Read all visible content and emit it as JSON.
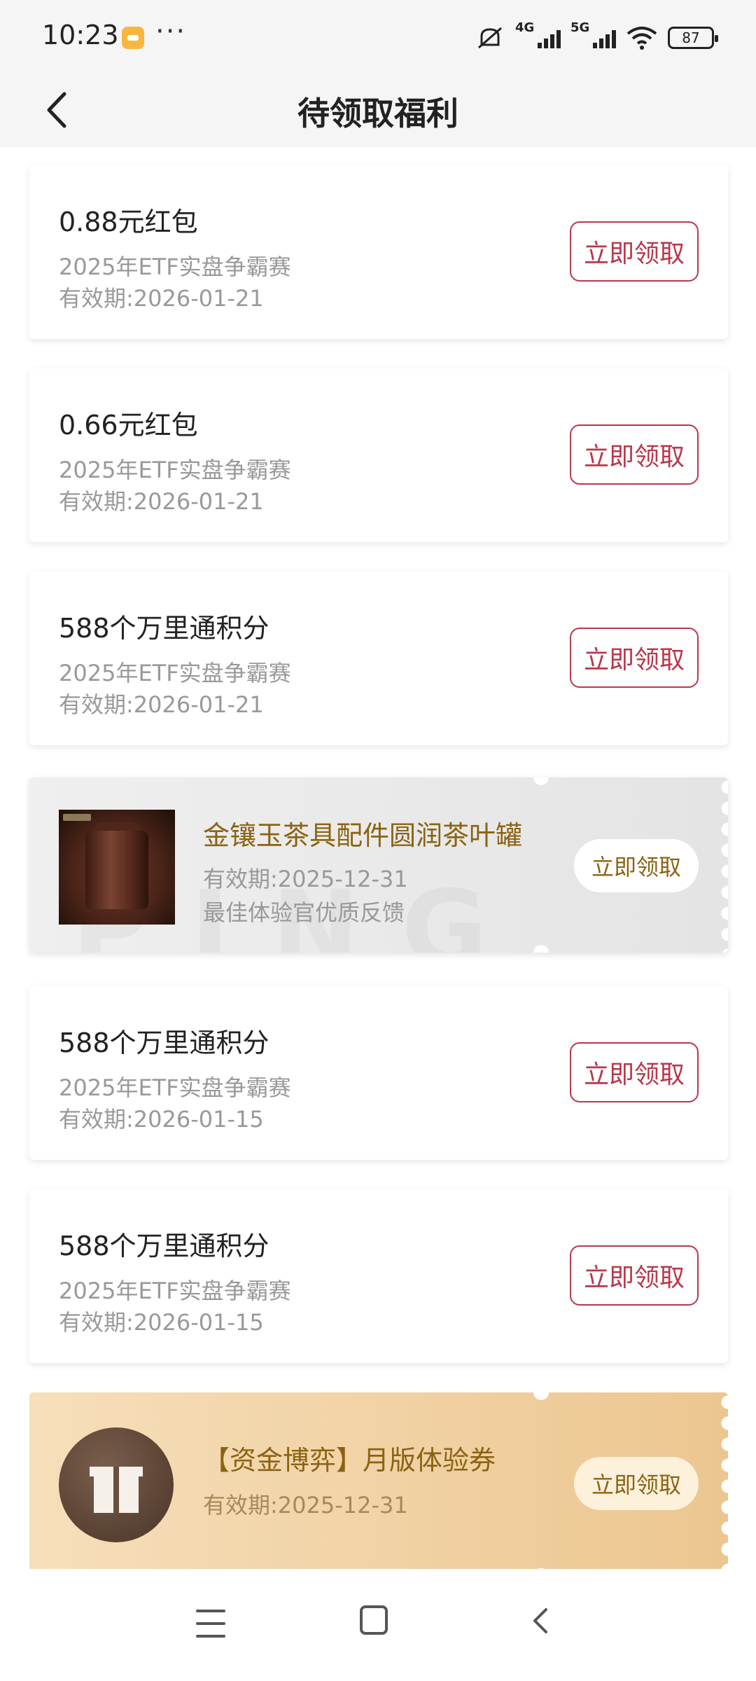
{
  "status_bar": {
    "time": "10:23",
    "dots": "···",
    "network_1": "4G",
    "network_2": "5G",
    "battery": "87"
  },
  "header": {
    "title": "待领取福利"
  },
  "cards": [
    {
      "title": "0.88元红包",
      "source": "2025年ETF实盘争霸赛",
      "valid": "有效期:2026-01-21",
      "button": "立即领取"
    },
    {
      "title": "0.66元红包",
      "source": "2025年ETF实盘争霸赛",
      "valid": "有效期:2026-01-21",
      "button": "立即领取"
    },
    {
      "title": "588个万里通积分",
      "source": "2025年ETF实盘争霸赛",
      "valid": "有效期:2026-01-21",
      "button": "立即领取"
    },
    {
      "title": "588个万里通积分",
      "source": "2025年ETF实盘争霸赛",
      "valid": "有效期:2026-01-15",
      "button": "立即领取"
    },
    {
      "title": "588个万里通积分",
      "source": "2025年ETF实盘争霸赛",
      "valid": "有效期:2026-01-15",
      "button": "立即领取"
    }
  ],
  "tea_coupon": {
    "title": "金镶玉茶具配件圆润茶叶罐",
    "valid": "有效期:2025-12-31",
    "note": "最佳体验官优质反馈",
    "button": "立即领取",
    "watermark": "PING AN"
  },
  "gold_coupon": {
    "title": "【资金博弈】月版体验券",
    "valid": "有效期:2025-12-31",
    "button": "立即领取"
  },
  "colors": {
    "accent": "#b8384b",
    "gold_text": "#8a6414",
    "muted": "#999999"
  }
}
